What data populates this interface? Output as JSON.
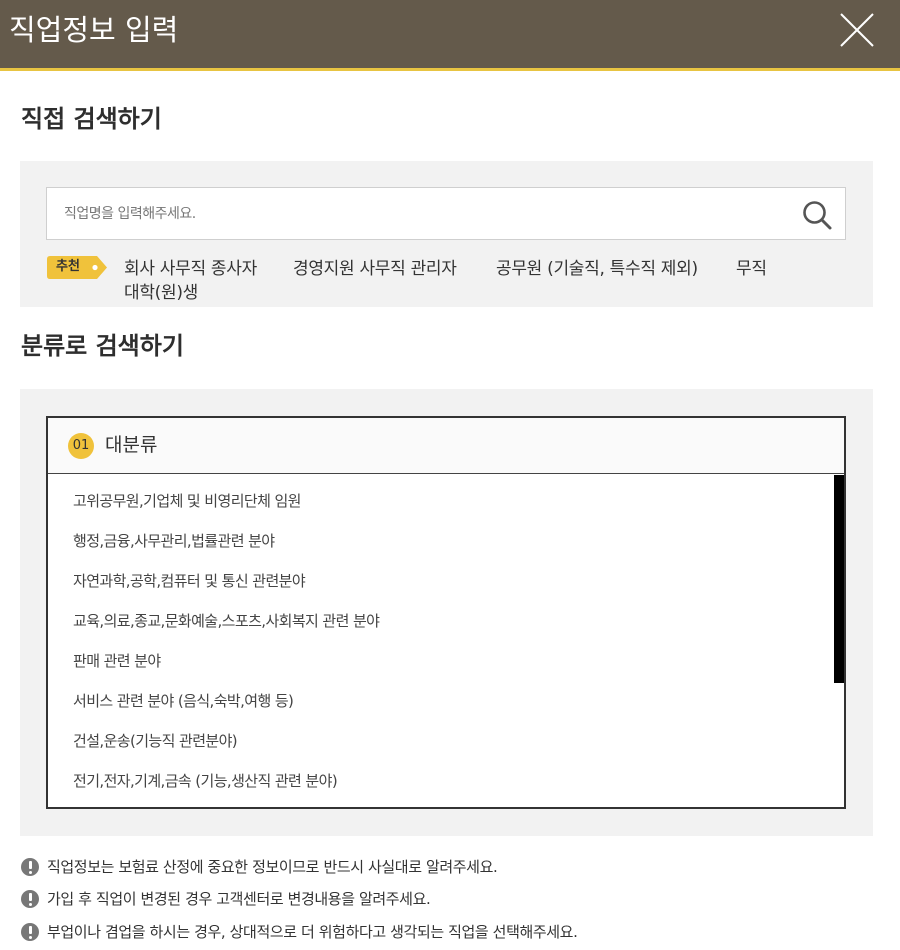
{
  "header": {
    "title": "직업정보 입력"
  },
  "direct_search": {
    "title": "직접 검색하기",
    "placeholder": "직업명을 입력해주세요.",
    "badge": "추천",
    "recommendations": [
      "회사 사무직 종사자",
      "경영지원 사무직 관리자",
      "공무원 (기술직, 특수직 제외)",
      "무직",
      "대학(원)생"
    ]
  },
  "category_search": {
    "title": "분류로 검색하기",
    "step_number": "01",
    "step_label": "대분류",
    "items": [
      "고위공무원,기업체 및 비영리단체 임원",
      "행정,금융,사무관리,법률관련 분야",
      "자연과학,공학,컴퓨터 및 통신 관련분야",
      "교육,의료,종교,문화예술,스포츠,사회복지 관련 분야",
      "판매 관련 분야",
      "서비스 관련 분야 (음식,숙박,여행 등)",
      "건설,운송(기능직 관련분야)",
      "전기,전자,기계,금속 (기능,생산직 관련 분야)"
    ]
  },
  "notices": [
    "직업정보는 보험료 산정에 중요한 정보이므로 반드시 사실대로 알려주세요.",
    "가입 후 직업이 변경된 경우 고객센터로 변경내용을 알려주세요.",
    "부업이나 겸업을 하시는 경우, 상대적으로 더 위험하다고 생각되는 직업을 선택해주세요."
  ],
  "colors": {
    "header_bg": "#645a4b",
    "accent": "#f0c23b",
    "header_border": "#e8c442",
    "panel_bg": "#f2f2f2"
  }
}
